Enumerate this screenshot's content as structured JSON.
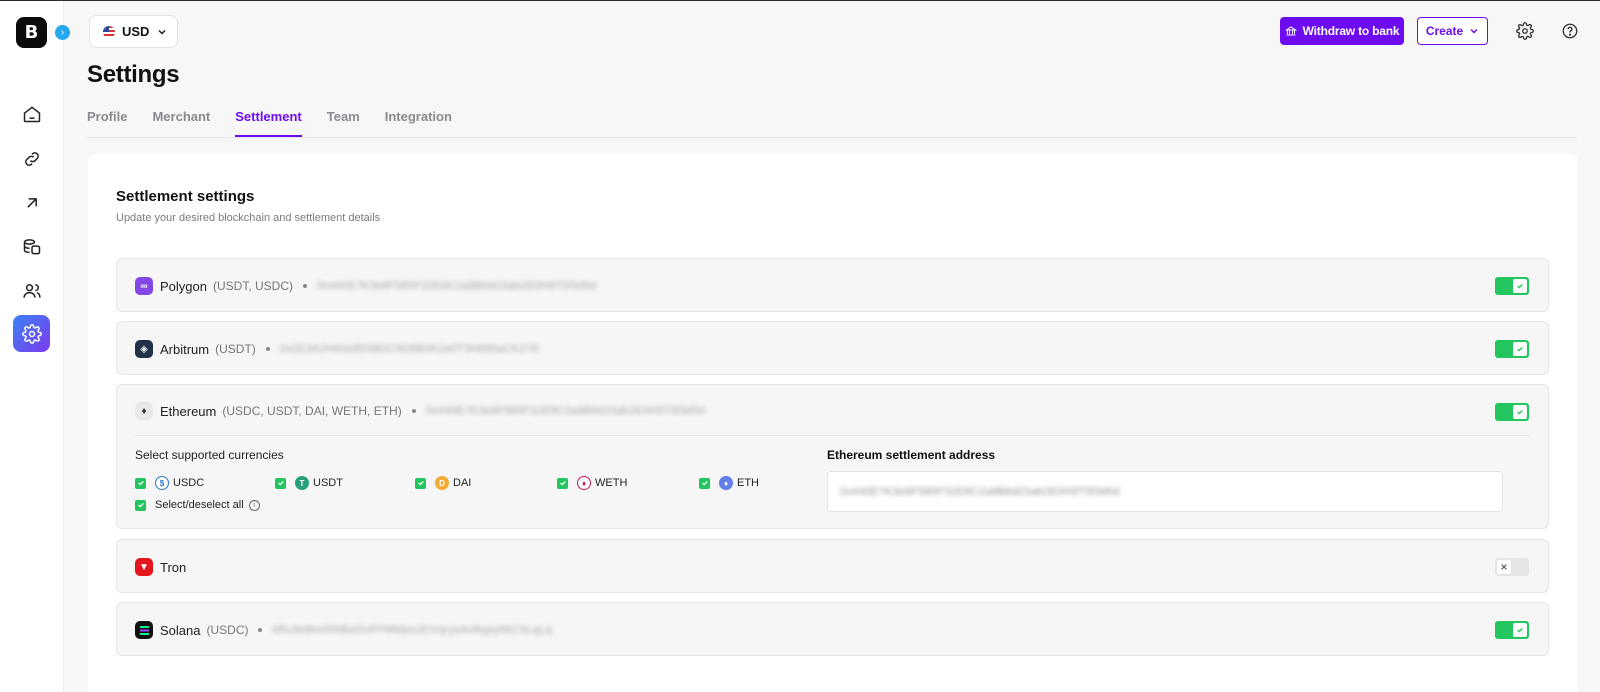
{
  "topbar": {
    "currency": "USD",
    "withdraw_label": "Withdraw to bank",
    "create_label": "Create"
  },
  "page": {
    "title": "Settings",
    "tabs": [
      {
        "label": "Profile",
        "active": false
      },
      {
        "label": "Merchant",
        "active": false
      },
      {
        "label": "Settlement",
        "active": true
      },
      {
        "label": "Team",
        "active": false
      },
      {
        "label": "Integration",
        "active": false
      }
    ]
  },
  "settings": {
    "title": "Settlement settings",
    "subtitle": "Update your desired blockchain and settlement details"
  },
  "chains": [
    {
      "name": "Polygon",
      "currencies": "(USDT, USDC)",
      "address": "0x440E7K3e8F585F32E8C2a8B6d23ab2E0H9T5f3d5d",
      "enabled": true
    },
    {
      "name": "Arbitrum",
      "currencies": "(USDT)",
      "address": "0x2E3A2H60e8D9B3C9D8B0K2e0T3H686aCK27E",
      "enabled": true
    },
    {
      "name": "Ethereum",
      "currencies": "(USDC, USDT, DAI, WETH, ETH)",
      "address": "0x440E7K3e8F585F32E8C2a8B6d23ab2E0H9T5f3d5d",
      "enabled": true
    },
    {
      "name": "Tron",
      "currencies": "",
      "address": "",
      "enabled": false
    },
    {
      "name": "Solana",
      "currencies": "(USDC)",
      "address": "6Ru9eBm5RdkwSvFFMMjoUEIVqrysAvRypyMiCSLqLq",
      "enabled": true
    }
  ],
  "ethereum_panel": {
    "select_label": "Select supported currencies",
    "currencies": [
      "USDC",
      "USDT",
      "DAI",
      "WETH",
      "ETH"
    ],
    "select_all_label": "Select/deselect all",
    "address_label": "Ethereum settlement address",
    "address_value": "0x440E7K3e8F585F32E8C2a8B6d23ab2E0H9T5f3d5d"
  },
  "colors": {
    "brand": "#6d0cf0",
    "toggle_on": "#22c55e",
    "polygon": "#8247e5",
    "arbitrum": "#213147",
    "tron": "#e5161d",
    "solana": "#111111"
  }
}
